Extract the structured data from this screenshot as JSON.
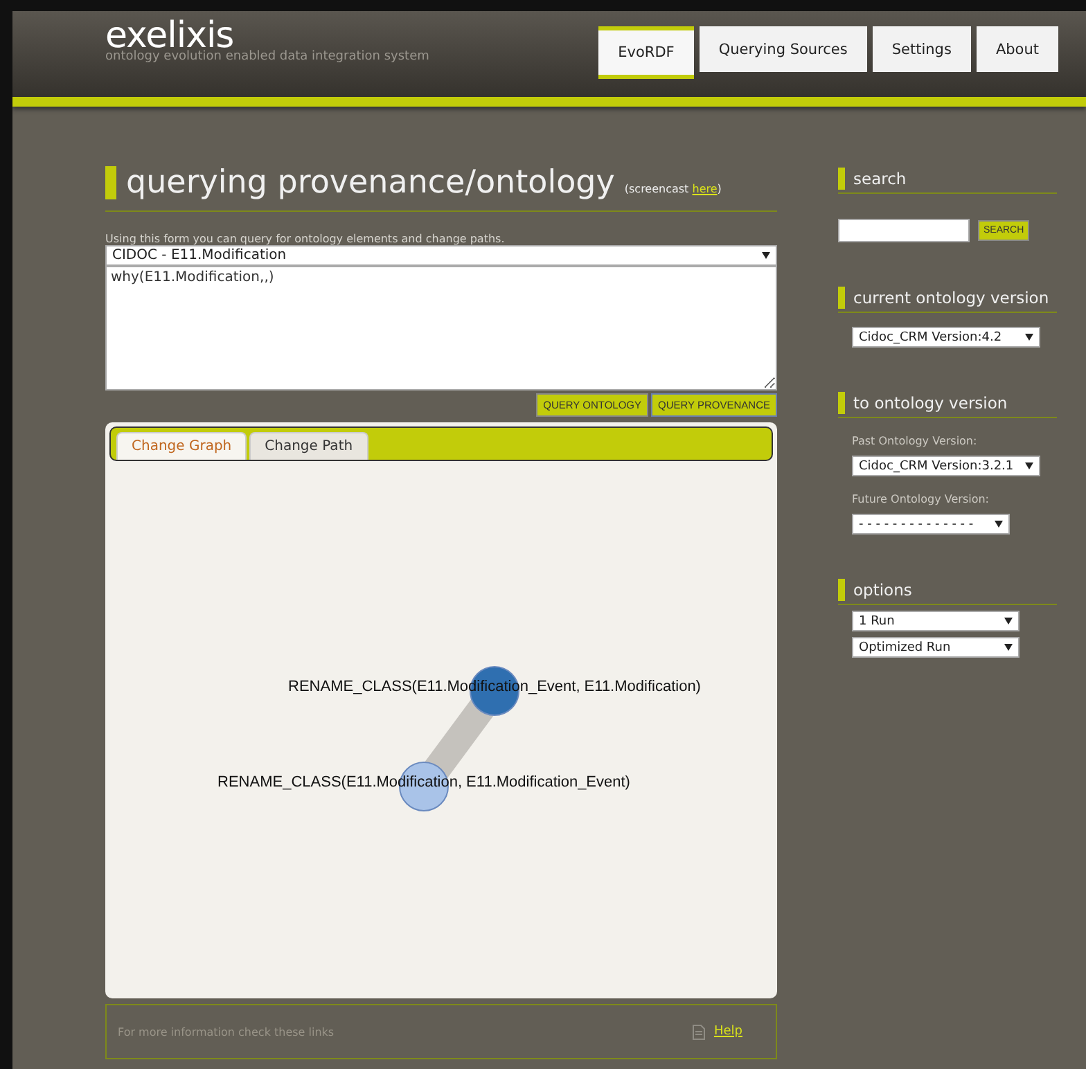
{
  "header": {
    "logo": "exelixis",
    "tagline": "ontology evolution enabled data integration system",
    "nav": [
      {
        "label": "EvoRDF",
        "selected": true
      },
      {
        "label": "Querying Sources",
        "selected": false
      },
      {
        "label": "Settings",
        "selected": false
      },
      {
        "label": "About",
        "selected": false
      }
    ]
  },
  "main": {
    "title": "querying provenance/ontology",
    "note_open": "(screencast ",
    "note_link": "here",
    "note_close": ")",
    "hint": "Using this form you can query for ontology elements and change paths.",
    "source_select": "CIDOC - E11.Modification",
    "query": "why(E11.Modification,,)",
    "buttons": [
      {
        "label": "QUERY ONTOLOGY",
        "focused": false
      },
      {
        "label": "QUERY PROVENANCE",
        "focused": true
      }
    ],
    "tabs": [
      {
        "label": "Change Graph",
        "selected": true
      },
      {
        "label": "Change Path",
        "selected": false
      }
    ],
    "graph": {
      "nodes": [
        {
          "label": "RENAME_CLASS(E11.Modification_Event, E11.Modification)",
          "color": "#2f6fb0"
        },
        {
          "label": "RENAME_CLASS(E11.Modification, E11.Modification_Event)",
          "color": "#a9c3e8"
        }
      ]
    },
    "footer": {
      "text": "For more information check these links",
      "link": "Help"
    }
  },
  "sidebar": {
    "search": {
      "title": "search",
      "button": "SEARCH"
    },
    "current": {
      "title": "current ontology version",
      "select": "Cidoc_CRM Version:4.2"
    },
    "to": {
      "title": "to ontology version",
      "past_label": "Past Ontology Version:",
      "past_select": "Cidoc_CRM Version:3.2.1",
      "future_label": "Future Ontology Version:",
      "future_select": "- - - - - - - - - - - - - -"
    },
    "options": {
      "title": "options",
      "selects": [
        "1 Run",
        "Optimized Run"
      ]
    }
  }
}
